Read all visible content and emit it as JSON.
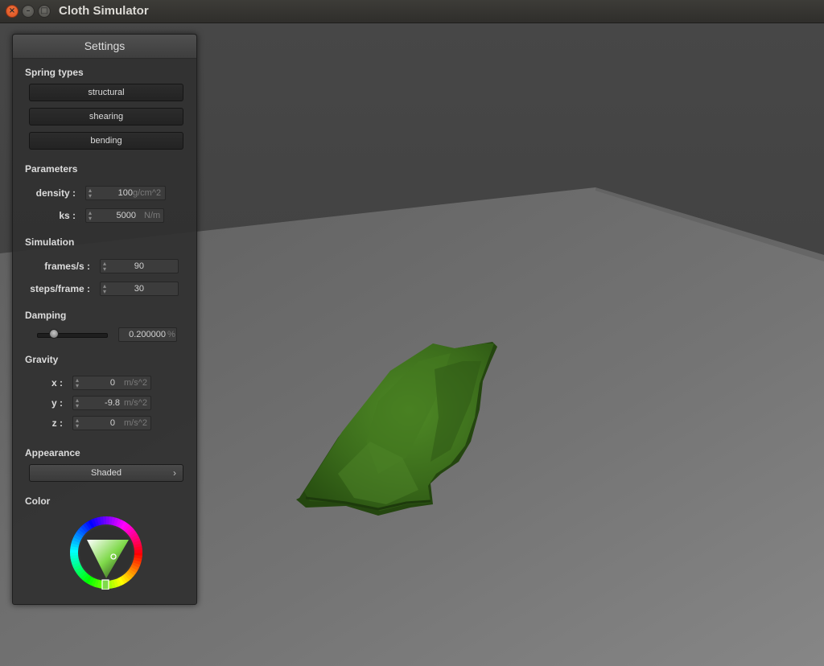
{
  "window": {
    "title": "Cloth Simulator",
    "close_glyph": "×",
    "min_glyph": "–",
    "max_glyph": "□"
  },
  "panel": {
    "title": "Settings",
    "spring_types": {
      "heading": "Spring types",
      "buttons": [
        "structural",
        "shearing",
        "bending"
      ]
    },
    "parameters": {
      "heading": "Parameters",
      "fields": [
        {
          "label": "density :",
          "value": "100",
          "unit": "g/cm^2"
        },
        {
          "label": "ks :",
          "value": "5000",
          "unit": "N/m"
        }
      ]
    },
    "simulation": {
      "heading": "Simulation",
      "fields": [
        {
          "label": "frames/s :",
          "value": "90"
        },
        {
          "label": "steps/frame :",
          "value": "30"
        }
      ]
    },
    "damping": {
      "heading": "Damping",
      "value": "0.200000",
      "unit": "%",
      "slider_fraction": 0.2
    },
    "gravity": {
      "heading": "Gravity",
      "fields": [
        {
          "label": "x :",
          "value": "0",
          "unit": "m/s^2"
        },
        {
          "label": "y :",
          "value": "-9.8",
          "unit": "m/s^2"
        },
        {
          "label": "z :",
          "value": "0",
          "unit": "m/s^2"
        }
      ]
    },
    "appearance": {
      "heading": "Appearance",
      "selected": "Shaded",
      "chevron_glyph": "›"
    },
    "color": {
      "heading": "Color",
      "value": "#4a8a1f"
    }
  },
  "colors": {
    "cloth": "#3d6e1c",
    "floor": "#6a6a6a",
    "accent_close": "#e5612b"
  }
}
